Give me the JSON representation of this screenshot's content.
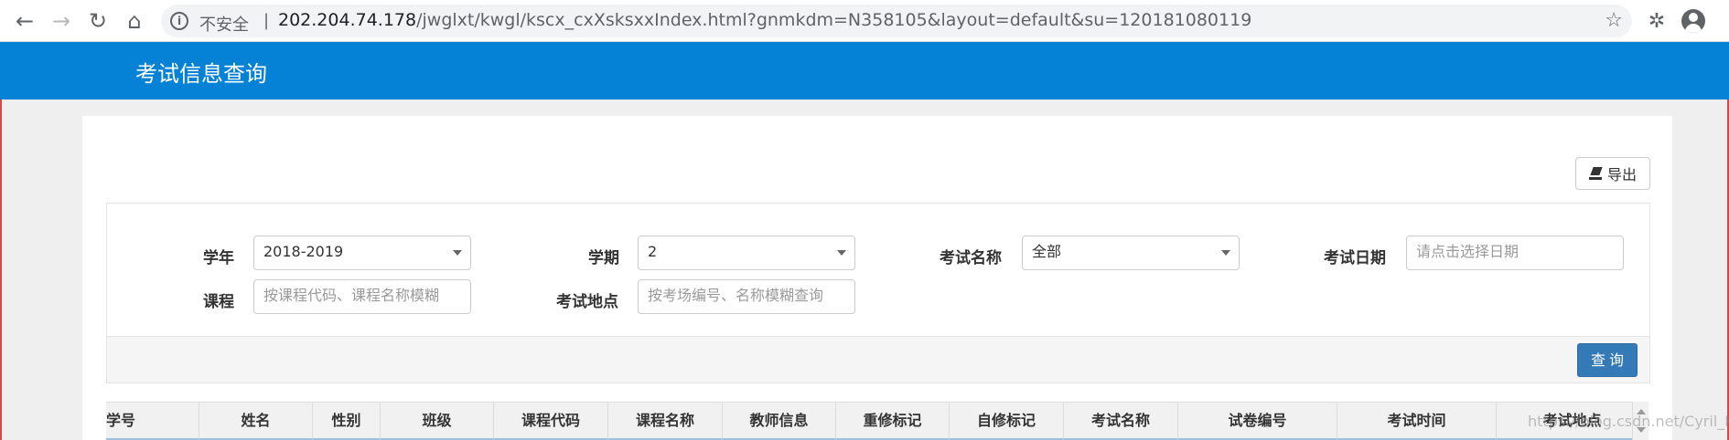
{
  "browser": {
    "security_label": "不安全",
    "separator": "|",
    "url_host": "202.204.74.178",
    "url_path": "/jwglxt/kwgl/kscx_cxXsksxxIndex.html?gnmkdm=N358105&layout=default&su=120181080119",
    "back_icon": "←",
    "forward_icon": "→",
    "reload_icon": "↻",
    "home_icon": "⌂",
    "star_icon": "☆",
    "extensions_icon": "✲"
  },
  "header": {
    "title": "考试信息查询",
    "bg_color": "#0581d5"
  },
  "toolbar": {
    "export_label": "导出"
  },
  "filters": {
    "year_label": "学年",
    "year_value": "2018-2019",
    "term_label": "学期",
    "term_value": "2",
    "exam_name_label": "考试名称",
    "exam_name_value": "全部",
    "exam_date_label": "考试日期",
    "exam_date_placeholder": "请点击选择日期",
    "course_label": "课程",
    "course_placeholder": "按课程代码、课程名称模糊",
    "location_label": "考试地点",
    "location_placeholder": "按考场编号、名称模糊查询",
    "query_label": "查询"
  },
  "table": {
    "columns": [
      "学号",
      "姓名",
      "性别",
      "班级",
      "课程代码",
      "课程名称",
      "教师信息",
      "重修标记",
      "自修标记",
      "考试名称",
      "试卷编号",
      "考试时间",
      "考试地点"
    ]
  },
  "watermark": "https://blog.csdn.net/Cyril_KI"
}
